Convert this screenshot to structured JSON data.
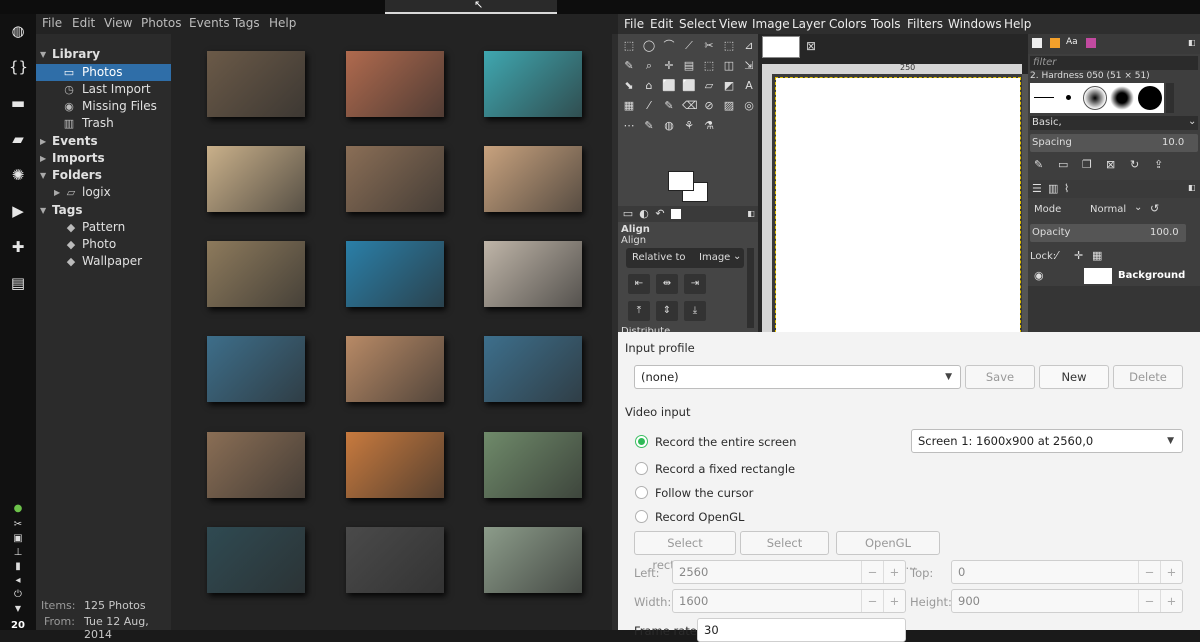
{
  "shotwell": {
    "menu": [
      "File",
      "Edit",
      "View",
      "Photos",
      "Events",
      "Tags",
      "Help"
    ],
    "sidebar": {
      "library": "Library",
      "photos": "Photos",
      "last_import": "Last Import",
      "missing_files": "Missing Files",
      "trash": "Trash",
      "events": "Events",
      "imports": "Imports",
      "folders": "Folders",
      "folder_logix": "logix",
      "tags": "Tags",
      "tag_pattern": "Pattern",
      "tag_photo": "Photo",
      "tag_wallpaper": "Wallpaper"
    },
    "status": {
      "items_label": "Items:",
      "items_value": "125 Photos",
      "from_label": "From:",
      "from_value": "Tue 12 Aug, 2014"
    },
    "thumbnail_colors": [
      [
        "#6b5a48",
        "#b06a4e",
        "#3fa7b0"
      ],
      [
        "#c9b08a",
        "#8a6e56",
        "#c8a27e"
      ],
      [
        "#8d7a5c",
        "#2a7fa8",
        "#bfb5a8"
      ],
      [
        "#3d6e8a",
        "#b88a66",
        "#3d6f8c"
      ],
      [
        "#8a6e55",
        "#c87a3e",
        "#6f8a6a"
      ],
      [
        "#2f4a52",
        "#4a4a4a",
        "#8c9c8a"
      ]
    ]
  },
  "gimp": {
    "menu": [
      "File",
      "Edit",
      "Select",
      "View",
      "Image",
      "Layer",
      "Colors",
      "Tools",
      "Filters",
      "Windows",
      "Help"
    ],
    "ruler_mark": "250",
    "align_title": "Align",
    "align_sub": "Align",
    "relative_to_label": "Relative to",
    "relative_to_value": "Image",
    "distribute_label": "Distribute",
    "filter_placeholder": "filter",
    "brush_name": "2. Hardness 050 (51 × 51)",
    "brush_set": "Basic,",
    "spacing_label": "Spacing",
    "spacing_value": "10.0",
    "mode_label": "Mode",
    "mode_value": "Normal",
    "opacity_label": "Opacity",
    "opacity_value": "100.0",
    "lock_label": "Lock:",
    "layer_name": "Background"
  },
  "obs": {
    "input_profile_label": "Input profile",
    "profile_value": "(none)",
    "save_btn": "Save",
    "new_btn": "New",
    "delete_btn": "Delete",
    "video_input_label": "Video input",
    "record_entire": "Record the entire screen",
    "record_fixed": "Record a fixed rectangle",
    "follow_cursor": "Follow the cursor",
    "record_opengl": "Record OpenGL",
    "screen_value": "Screen 1: 1600x900 at 2560,0",
    "select_rect_btn": "Select rectangle...",
    "select_window_btn": "Select window...",
    "opengl_settings_btn": "OpenGL settings...",
    "left_label": "Left:",
    "left_value": "2560",
    "top_label": "Top:",
    "top_value": "0",
    "width_label": "Width:",
    "width_value": "1600",
    "height_label": "Height:",
    "height_value": "900",
    "frame_rate_label": "Frame rate:",
    "frame_rate_value": "30"
  },
  "dock": {
    "clock": "20"
  }
}
